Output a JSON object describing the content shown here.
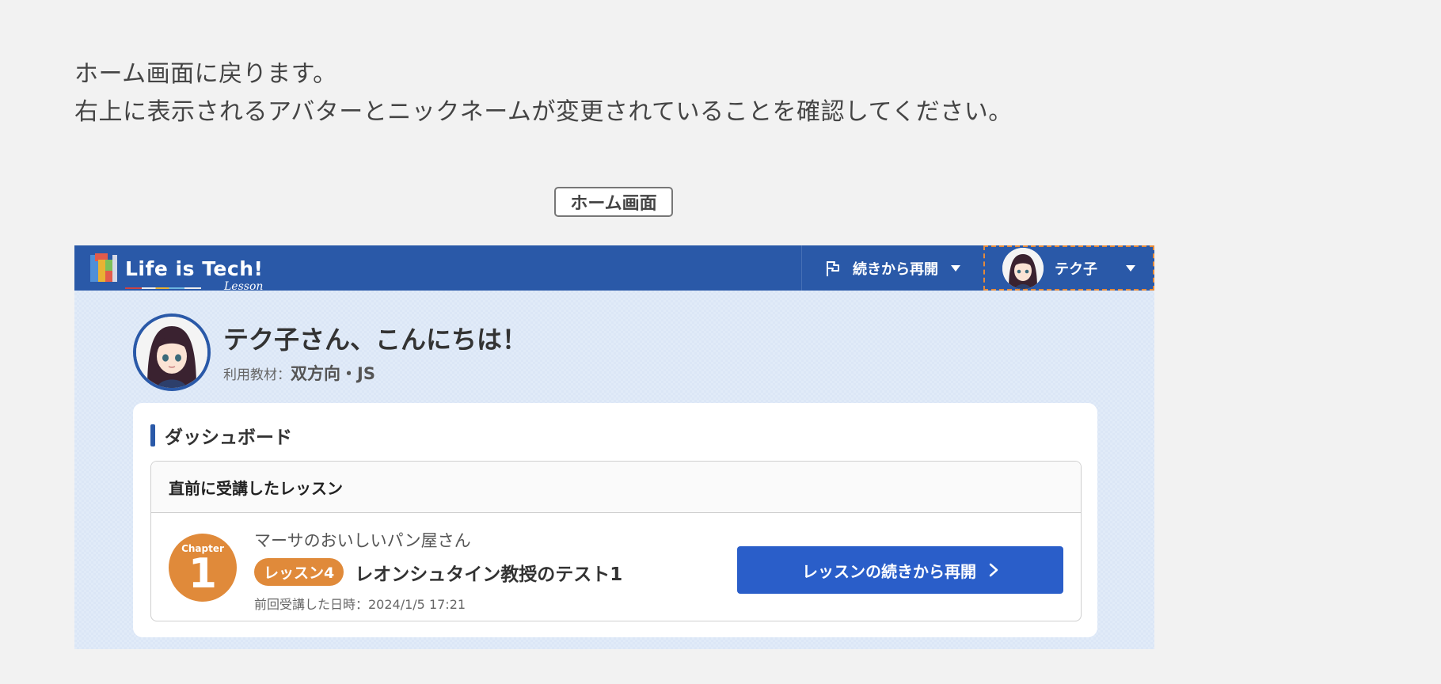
{
  "instructions": {
    "line1": "ホーム画面に戻ります。",
    "line2": "右上に表示されるアバターとニックネームが変更されていることを確認してください。"
  },
  "caption": "ホーム画面",
  "header": {
    "logo_text": "Life is Tech!",
    "logo_sub": "Lesson",
    "resume_menu_label": "続きから再開",
    "user_nickname": "テク子",
    "icons": [
      "logo-icon",
      "flag-icon",
      "caret-down-icon",
      "avatar"
    ]
  },
  "greeting": {
    "title": "テク子さん、こんにちは！",
    "material_label": "利用教材：",
    "material_value": "双方向・JS"
  },
  "dashboard": {
    "title": "ダッシュボード",
    "last_lesson": {
      "heading": "直前に受講したレッスン",
      "chapter_label": "Chapter",
      "chapter_number": "1",
      "course_name": "マーサのおいしいパン屋さん",
      "lesson_tag": "レッスン4",
      "lesson_title": "レオンシュタイン教授のテスト1",
      "last_taken": "前回受講した日時：2024/1/5 17:21",
      "resume_button": "レッスンの続きから再開"
    }
  },
  "colors": {
    "header_bg": "#2a59a8",
    "accent_orange": "#e08a3a",
    "button_blue": "#2a5ec9",
    "highlight_dashed": "#e58a3a"
  }
}
